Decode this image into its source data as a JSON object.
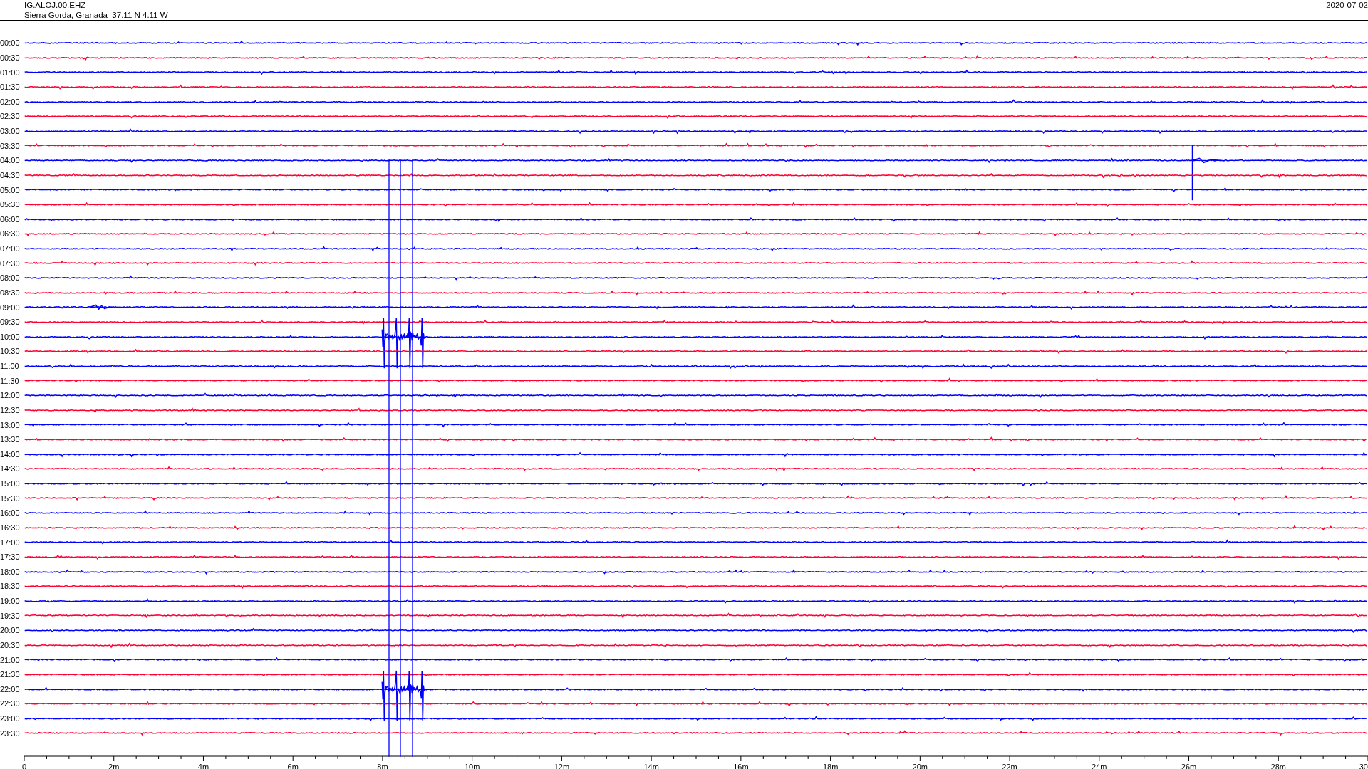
{
  "header": {
    "station": "IG.ALOJ.00.EHZ",
    "location": "Sierra Gorda, Granada  37.11 N 4.11 W",
    "date": "2020-07-02"
  },
  "rows": [
    {
      "time": "00:00",
      "color": "#0000ff"
    },
    {
      "time": "00:30",
      "color": "#ff0033"
    },
    {
      "time": "01:00",
      "color": "#0000ff"
    },
    {
      "time": "01:30",
      "color": "#ff0033"
    },
    {
      "time": "02:00",
      "color": "#0000ff"
    },
    {
      "time": "02:30",
      "color": "#ff0033"
    },
    {
      "time": "03:00",
      "color": "#0000ff"
    },
    {
      "time": "03:30",
      "color": "#ff0033"
    },
    {
      "time": "04:00",
      "color": "#0000ff"
    },
    {
      "time": "04:30",
      "color": "#ff0033"
    },
    {
      "time": "05:00",
      "color": "#0000ff"
    },
    {
      "time": "05:30",
      "color": "#ff0033"
    },
    {
      "time": "06:00",
      "color": "#0000ff"
    },
    {
      "time": "06:30",
      "color": "#ff0033"
    },
    {
      "time": "07:00",
      "color": "#0000ff"
    },
    {
      "time": "07:30",
      "color": "#ff0033"
    },
    {
      "time": "08:00",
      "color": "#0000ff"
    },
    {
      "time": "08:30",
      "color": "#ff0033"
    },
    {
      "time": "09:00",
      "color": "#0000ff"
    },
    {
      "time": "09:30",
      "color": "#ff0033"
    },
    {
      "time": "10:00",
      "color": "#0000ff"
    },
    {
      "time": "10:30",
      "color": "#ff0033"
    },
    {
      "time": "11:00",
      "color": "#0000ff"
    },
    {
      "time": "11:30",
      "color": "#ff0033"
    },
    {
      "time": "12:00",
      "color": "#0000ff"
    },
    {
      "time": "12:30",
      "color": "#ff0033"
    },
    {
      "time": "13:00",
      "color": "#0000ff"
    },
    {
      "time": "13:30",
      "color": "#ff0033"
    },
    {
      "time": "14:00",
      "color": "#0000ff"
    },
    {
      "time": "14:30",
      "color": "#ff0033"
    },
    {
      "time": "15:00",
      "color": "#0000ff"
    },
    {
      "time": "15:30",
      "color": "#ff0033"
    },
    {
      "time": "16:00",
      "color": "#0000ff"
    },
    {
      "time": "16:30",
      "color": "#ff0033"
    },
    {
      "time": "17:00",
      "color": "#0000ff"
    },
    {
      "time": "17:30",
      "color": "#ff0033"
    },
    {
      "time": "18:00",
      "color": "#0000ff"
    },
    {
      "time": "18:30",
      "color": "#ff0033"
    },
    {
      "time": "19:00",
      "color": "#0000ff"
    },
    {
      "time": "19:30",
      "color": "#ff0033"
    },
    {
      "time": "20:00",
      "color": "#0000ff"
    },
    {
      "time": "20:30",
      "color": "#ff0033"
    },
    {
      "time": "21:00",
      "color": "#0000ff"
    },
    {
      "time": "21:30",
      "color": "#ff0033"
    },
    {
      "time": "22:00",
      "color": "#0000ff"
    },
    {
      "time": "22:30",
      "color": "#ff0033"
    },
    {
      "time": "23:00",
      "color": "#0000ff"
    },
    {
      "time": "23:30",
      "color": "#ff0033"
    }
  ],
  "x_axis_labels": [
    "0",
    "2m",
    "4m",
    "6m",
    "8m",
    "10m",
    "12m",
    "14m",
    "16m",
    "18m",
    "20m",
    "22m",
    "24m",
    "26m",
    "28m",
    "30"
  ]
}
